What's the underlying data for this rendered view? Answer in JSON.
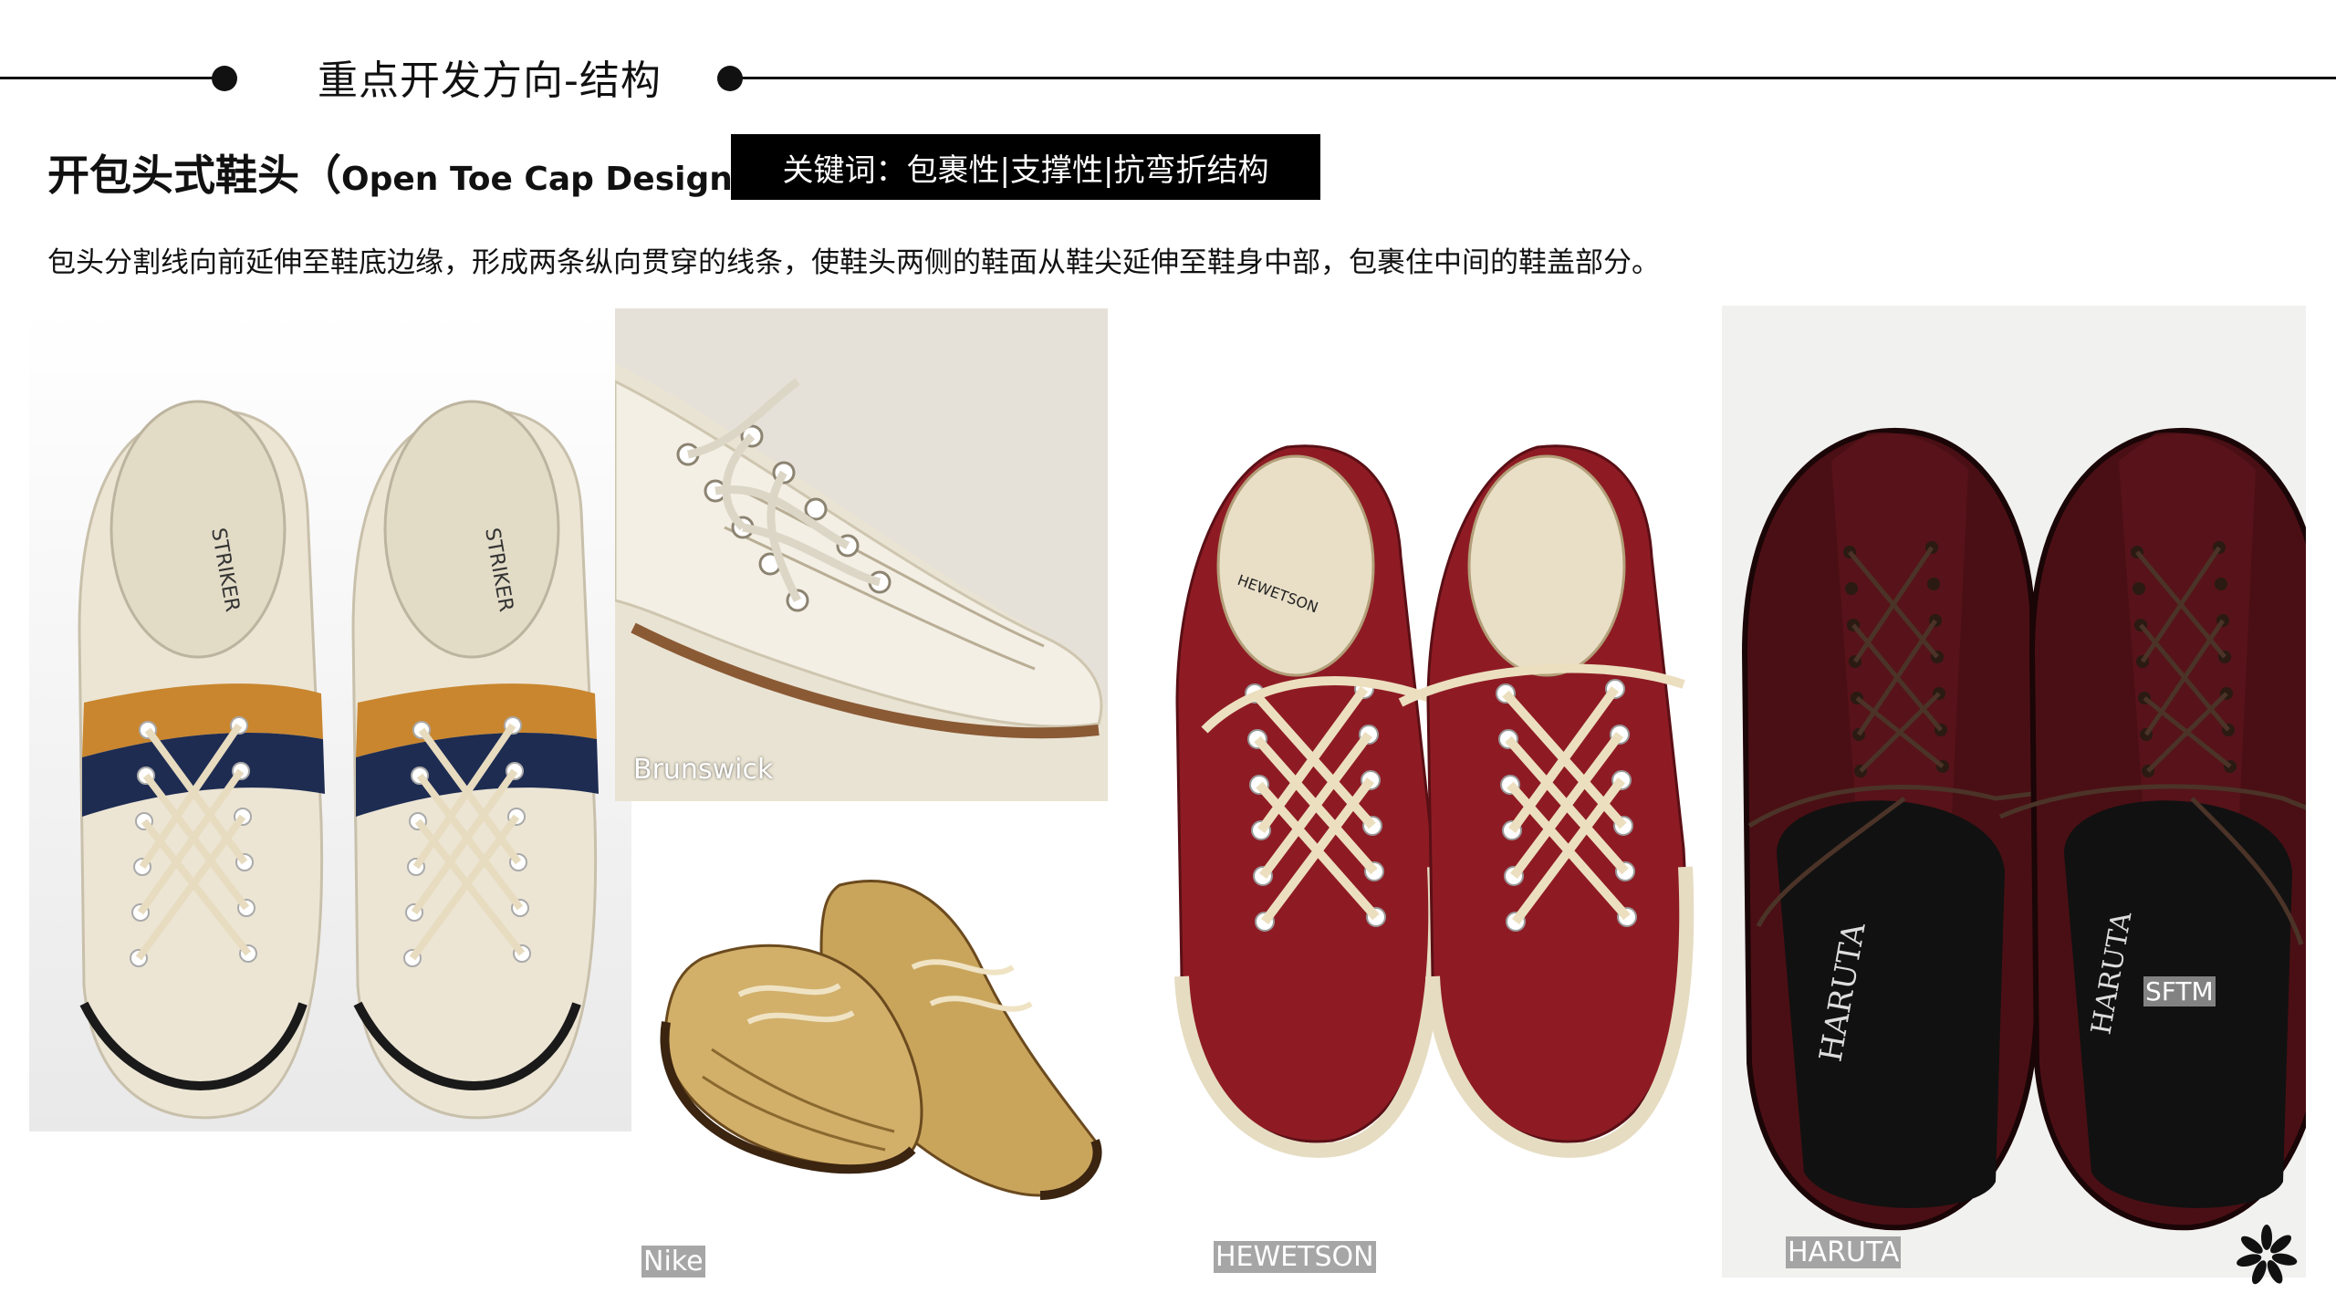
{
  "header": {
    "section_title": "重点开发方向-结构"
  },
  "heading": {
    "cn": "开包头式鞋头",
    "open_paren": "（",
    "en": "Open Toe Cap Design",
    "close_paren": "）"
  },
  "keywords": "关键词：包裹性|支撑性|抗弯折结构",
  "description": "包头分割线向前延伸至鞋底边缘，形成两条纵向贯穿的线条，使鞋头两侧的鞋面从鞋尖延伸至鞋身中部，包裹住中间的鞋盖部分。",
  "captions": {
    "brunswick": "Brunswick",
    "nike": "Nike",
    "hewetson": "HEWETSON",
    "haruta": "HARUTA",
    "sftm": "SFTM"
  },
  "shoe_print": {
    "striker": "STRIKER",
    "hewetson_logo": "HEWETSON",
    "haruta_insole": "HARUTA"
  },
  "colors": {
    "black": "#000000",
    "cream_leather": "#ece5d4",
    "red_leather": "#8e1b24",
    "burgundy_leather": "#4a0f14",
    "tan_leather": "#c9a55c"
  },
  "icons": [
    "flower-logo-icon"
  ]
}
